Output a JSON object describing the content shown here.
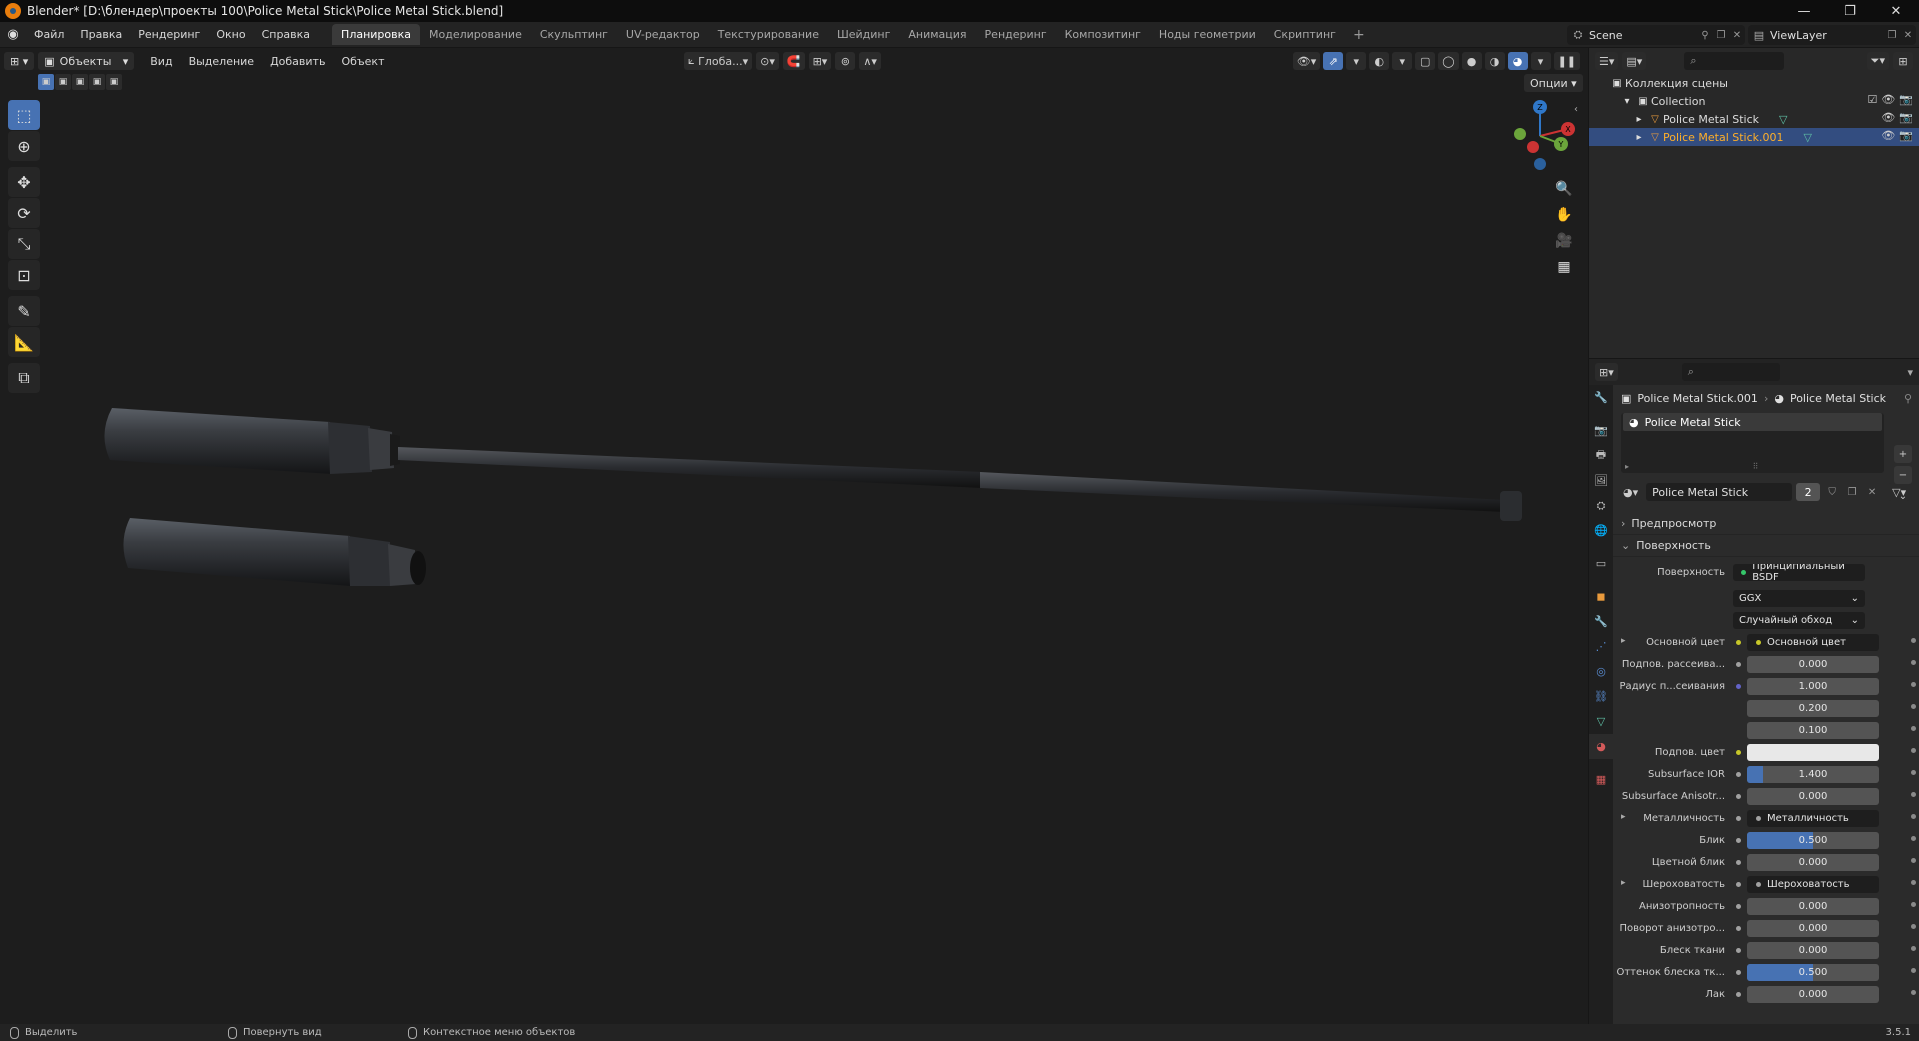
{
  "window": {
    "title": "Blender* [D:\\блендер\\проекты 100\\Police Metal Stick\\Police Metal Stick.blend]",
    "controls": [
      "—",
      "❐",
      "✕"
    ]
  },
  "menu": [
    "Файл",
    "Правка",
    "Рендеринг",
    "Окно",
    "Справка"
  ],
  "workspaces": [
    "Планировка",
    "Моделирование",
    "Скульптинг",
    "UV-редактор",
    "Текстурирование",
    "Шейдинг",
    "Анимация",
    "Рендеринг",
    "Композитинг",
    "Ноды геометрии",
    "Скриптинг"
  ],
  "active_workspace": "Планировка",
  "add_workspace": "+",
  "scene": "Scene",
  "view_layer": "ViewLayer",
  "viewport": {
    "mode": "Объекты",
    "menu": [
      "Вид",
      "Выделение",
      "Добавить",
      "Объект"
    ],
    "transform_orientation": "Глоба...",
    "options": "Опции"
  },
  "outliner": {
    "scene_collection": "Коллекция сцены",
    "collection": "Collection",
    "objects": [
      {
        "name": "Police Metal Stick",
        "selected": false
      },
      {
        "name": "Police Metal Stick.001",
        "selected": true
      }
    ]
  },
  "properties": {
    "breadcrumb_object": "Police Metal Stick.001",
    "breadcrumb_material": "Police Metal Stick",
    "slot_name": "Police Metal Stick",
    "material_name": "Police Metal Stick",
    "user_count": "2",
    "panel_preview": "Предпросмотр",
    "panel_surface": "Поверхность",
    "surface_label": "Поверхность",
    "surface_value": "Принципиальный BSDF",
    "distribution": "GGX",
    "subsurface_method": "Случайный обход",
    "rows": [
      {
        "label": "Основной цвет",
        "value": "Основной цвет",
        "kind": "link",
        "dot": "yellow",
        "expand": true
      },
      {
        "label": "Подпов. рассеива...",
        "value": "0.000",
        "kind": "number",
        "dot": "grey"
      },
      {
        "label": "Радиус п...сеивания",
        "value": "1.000",
        "kind": "number",
        "dot": "purple"
      },
      {
        "label": "",
        "value": "0.200",
        "kind": "number",
        "dot": ""
      },
      {
        "label": "",
        "value": "0.100",
        "kind": "number",
        "dot": ""
      },
      {
        "label": "Подпов. цвет",
        "value": "",
        "kind": "color",
        "dot": "yellow"
      },
      {
        "label": "Subsurface IOR",
        "value": "1.400",
        "kind": "slider",
        "fill": 0.12,
        "dot": "grey"
      },
      {
        "label": "Subsurface Anisotr...",
        "value": "0.000",
        "kind": "number",
        "dot": "grey"
      },
      {
        "label": "Металличность",
        "value": "Металличность",
        "kind": "link",
        "dot": "grey",
        "expand": true
      },
      {
        "label": "Блик",
        "value": "0.500",
        "kind": "slider",
        "fill": 0.5,
        "dot": "grey"
      },
      {
        "label": "Цветной блик",
        "value": "0.000",
        "kind": "number",
        "dot": "grey"
      },
      {
        "label": "Шероховатость",
        "value": "Шероховатость",
        "kind": "link",
        "dot": "grey",
        "expand": true
      },
      {
        "label": "Анизотропность",
        "value": "0.000",
        "kind": "number",
        "dot": "grey"
      },
      {
        "label": "Поворот анизотро...",
        "value": "0.000",
        "kind": "number",
        "dot": "grey"
      },
      {
        "label": "Блеск ткани",
        "value": "0.000",
        "kind": "number",
        "dot": "grey"
      },
      {
        "label": "Оттенок блеска тк...",
        "value": "0.500",
        "kind": "slider",
        "fill": 0.5,
        "dot": "grey"
      },
      {
        "label": "Лак",
        "value": "0.000",
        "kind": "number",
        "dot": "grey"
      }
    ]
  },
  "status": {
    "left": "Выделить",
    "middle": "Повернуть вид",
    "right": "Контекстное меню объектов",
    "version": "3.5.1"
  },
  "gizmo": {
    "x": "X",
    "y": "Y",
    "z": "Z"
  },
  "colors": {
    "accent": "#4772b3",
    "selected_text": "#ffaf29",
    "x_axis": "#cc3333",
    "y_axis": "#6ba53b",
    "z_axis": "#2f77c8"
  }
}
